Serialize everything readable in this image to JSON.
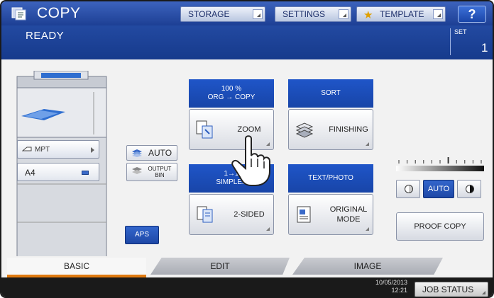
{
  "header": {
    "app_title": "COPY",
    "status": "READY",
    "storage_label": "STORAGE",
    "settings_label": "SETTINGS",
    "template_label": "TEMPLATE",
    "help_label": "?",
    "set_label": "SET",
    "set_value": "1"
  },
  "paper": {
    "mpt_label": "MPT",
    "tray_label": "A4",
    "auto_label": "AUTO",
    "output_bin_label": "OUTPUT BIN",
    "aps_label": "APS"
  },
  "functions": {
    "zoom_header": "100 %",
    "zoom_header_sub": "ORG → COPY",
    "zoom_label": "ZOOM",
    "sort_header": "SORT",
    "finishing_label": "FINISHING",
    "duplex_header": "1→1",
    "duplex_header_sub": "SIMPLEX",
    "two_sided_label": "2-SIDED",
    "orig_header": "TEXT/PHOTO",
    "original_mode_label": "ORIGINAL MODE"
  },
  "density": {
    "auto_label": "AUTO",
    "level": 0.55
  },
  "proof_copy_label": "PROOF COPY",
  "tabs": [
    "BASIC",
    "EDIT",
    "IMAGE"
  ],
  "footer": {
    "date": "10/05/2013",
    "time": "12:21",
    "job_status_label": "JOB STATUS"
  },
  "colors": {
    "header_blue": "#1d3f94",
    "button_blue": "#1f55c8",
    "tab_accent": "#e07a10"
  }
}
